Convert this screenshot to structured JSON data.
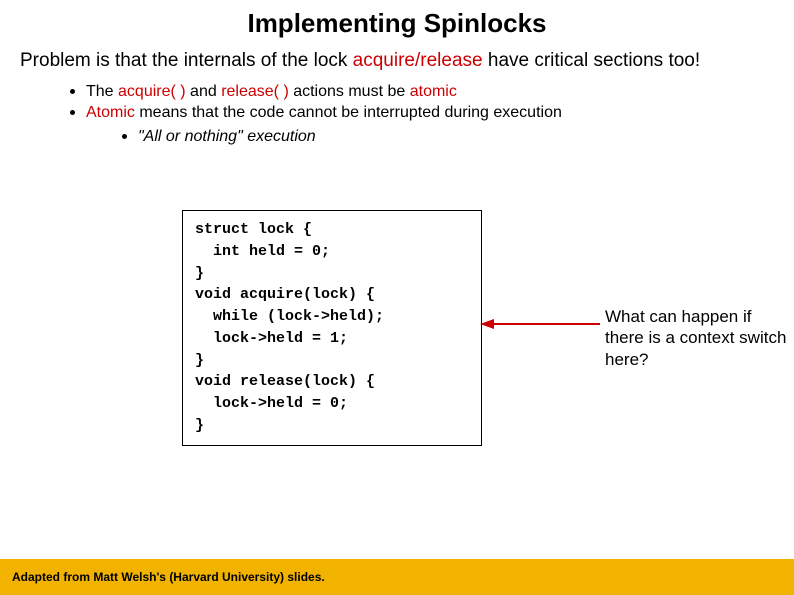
{
  "title": "Implementing Spinlocks",
  "intro": {
    "pre": "Problem is that the internals of the lock ",
    "hl": "acquire/release",
    "post": " have critical sections too!"
  },
  "bullets": [
    {
      "pre": "The ",
      "hl1": "acquire( )",
      "mid": " and ",
      "hl2": "release( )",
      "post": " actions must be ",
      "hl3": "atomic"
    },
    {
      "pre": "",
      "hl1": "Atomic",
      "mid": " means that the code cannot be interrupted during execution",
      "hl2": "",
      "post": "",
      "hl3": ""
    }
  ],
  "subbullet": "\"All or nothing\" execution",
  "code": "struct lock {\n  int held = 0;\n}\nvoid acquire(lock) {\n  while (lock->held);\n  lock->held = 1;\n}\nvoid release(lock) {\n  lock->held = 0;\n}",
  "annotation": "What can happen if there is a context switch here?",
  "footer": "Adapted from Matt Welsh's (Harvard University) slides.",
  "colors": {
    "accent": "#cc0000",
    "footer_bg": "#f2b300"
  }
}
